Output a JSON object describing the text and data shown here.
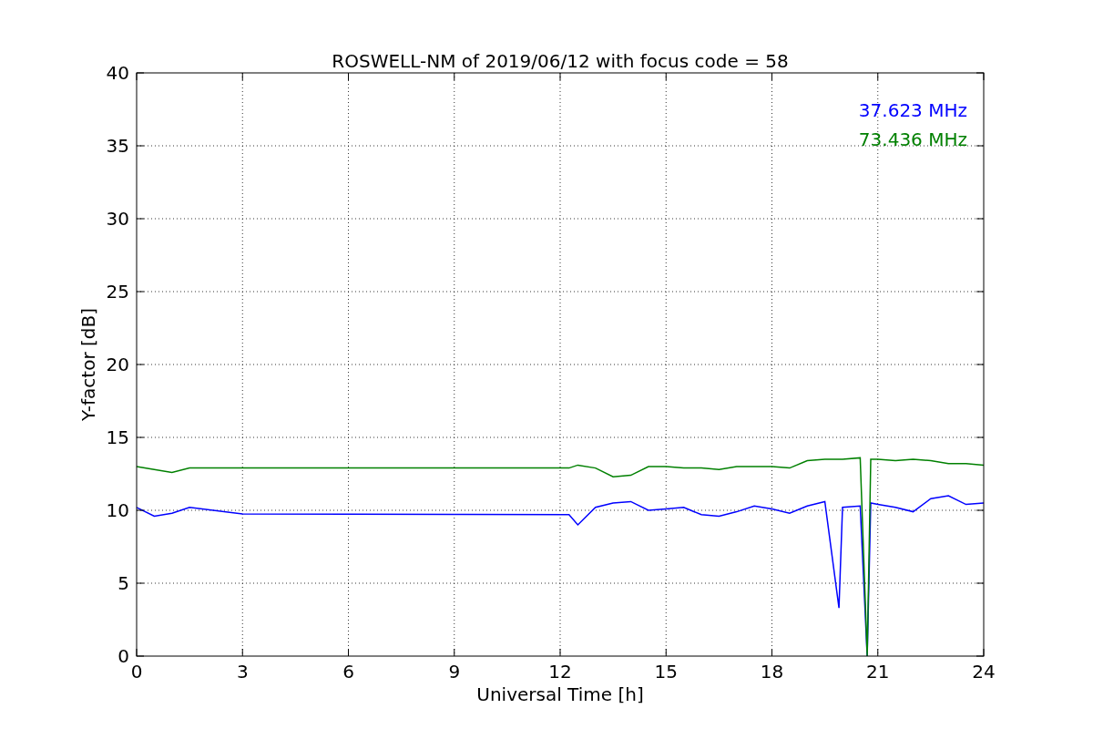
{
  "chart_data": {
    "type": "line",
    "title": "ROSWELL-NM of 2019/06/12 with focus code = 58",
    "xlabel": "Universal Time [h]",
    "ylabel": "Y-factor [dB]",
    "x": [
      0,
      0.5,
      1,
      1.5,
      3,
      6,
      9,
      12.25,
      12.5,
      13,
      13.5,
      14,
      14.5,
      15,
      15.5,
      16,
      16.5,
      17,
      17.5,
      18,
      18.5,
      19,
      19.5,
      19.9,
      20,
      20.5,
      20.7,
      20.8,
      21,
      21.5,
      22,
      22.5,
      23,
      23.5,
      24
    ],
    "series": [
      {
        "name": "37.623 MHz",
        "color": "#0000ff",
        "values": [
          10.2,
          9.6,
          9.8,
          10.2,
          9.75,
          9.73,
          9.72,
          9.7,
          9.0,
          10.2,
          10.5,
          10.6,
          10.0,
          10.1,
          10.2,
          9.7,
          9.6,
          9.9,
          10.3,
          10.1,
          9.8,
          10.3,
          10.6,
          3.3,
          10.2,
          10.3,
          0,
          10.5,
          10.4,
          10.2,
          9.9,
          10.8,
          11.0,
          10.4,
          10.5
        ]
      },
      {
        "name": "73.436 MHz",
        "color": "#008000",
        "values": [
          13.0,
          12.8,
          12.6,
          12.9,
          12.9,
          12.9,
          12.9,
          12.9,
          13.1,
          12.9,
          12.3,
          12.4,
          13.0,
          13.0,
          12.9,
          12.9,
          12.8,
          13.0,
          13.0,
          13.0,
          12.9,
          13.4,
          13.5,
          13.5,
          13.5,
          13.6,
          0,
          13.5,
          13.5,
          13.4,
          13.5,
          13.4,
          13.2,
          13.2,
          13.1
        ]
      }
    ],
    "xlim": [
      0,
      24
    ],
    "ylim": [
      0,
      40
    ],
    "xticks": [
      0,
      3,
      6,
      9,
      12,
      15,
      18,
      21,
      24
    ],
    "yticks": [
      0,
      5,
      10,
      15,
      20,
      25,
      30,
      35,
      40
    ],
    "grid": true
  }
}
